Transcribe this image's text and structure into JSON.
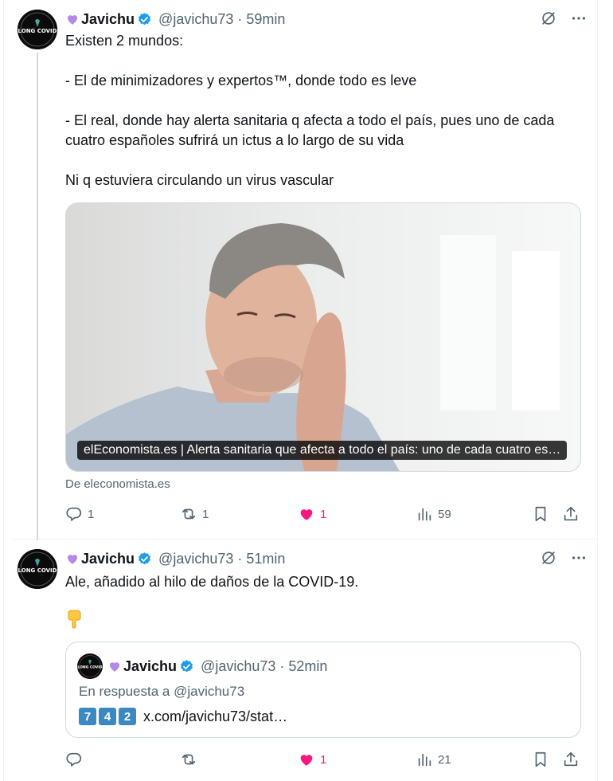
{
  "colors": {
    "accent": "#1d9bf0",
    "like": "#f91880",
    "muted": "#536471",
    "heart_emoji": "#b388e6"
  },
  "tweets": [
    {
      "author_name": "Javichu",
      "handle": "@javichu73",
      "time": "59min",
      "avatar_label": "LONG COVID",
      "text": "Existen 2 mundos:\n\n- El de minimizadores y expertos™, donde todo es leve\n\n- El real, donde hay alerta sanitaria q afecta a todo el país, pues uno de cada cuatro españoles sufrirá un ictus a lo largo de su vida\n\nNi q estuviera circulando un virus vascular",
      "card": {
        "caption": "elEconomista.es | Alerta sanitaria que afecta a todo el país: uno de cada cuatro es…",
        "source": "De eleconomista.es"
      },
      "stats": {
        "replies": "1",
        "retweets": "1",
        "likes": "1",
        "views": "59"
      }
    },
    {
      "author_name": "Javichu",
      "handle": "@javichu73",
      "time": "51min",
      "avatar_label": "LONG COVID",
      "text": "Ale, añadido al hilo de daños de la COVID-19.",
      "emoji_icon": "pointing-down-emoji",
      "quote": {
        "author_name": "Javichu",
        "handle": "@javichu73",
        "time": "52min",
        "reply_to": "En respuesta a @javichu73",
        "keycaps": [
          "7",
          "4",
          "2"
        ],
        "link": "x.com/javichu73/stat…"
      },
      "stats": {
        "replies": "",
        "retweets": "",
        "likes": "1",
        "views": "21"
      }
    }
  ],
  "icons": [
    "heart-emoji-icon",
    "verified-badge-icon",
    "grok-icon",
    "more-icon",
    "reply-icon",
    "retweet-icon",
    "like-icon",
    "views-icon",
    "bookmark-icon",
    "share-icon"
  ]
}
